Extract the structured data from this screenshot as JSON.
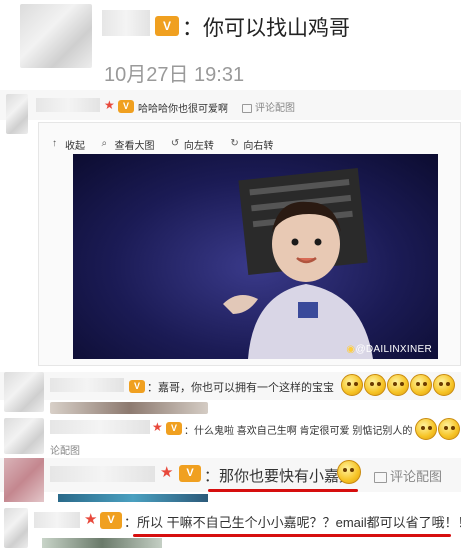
{
  "top": {
    "reply_text": "：你可以找山鸡哥",
    "timestamp": "10月27日 19:31"
  },
  "comment1": {
    "text": "哈哈哈你也很可爱啊",
    "action": "评论配图"
  },
  "image_viewer": {
    "toolbar": {
      "collapse": "收起",
      "view_large": "查看大图",
      "rotate_left": "向左转",
      "rotate_right": "向右转"
    },
    "watermark": "@DAILINXINER"
  },
  "comment2": {
    "text": "：嘉哥，你也可以拥有一个这样的宝宝"
  },
  "comment3": {
    "text": "：什么鬼啦 喜欢自己生啊 肯定很可爱 别惦记别人的"
  },
  "comment3_tail": {
    "text": "论配图"
  },
  "comment4": {
    "text": "：那你也要快有小嘉嘉",
    "action": "评论配图"
  },
  "comment5": {
    "text": "：所以 干嘛不自己生个小小嘉呢？？email都可以省了哦！！"
  },
  "colors": {
    "accent_red": "#d60e0e",
    "star": "#e8493c",
    "vip_badge": "#f0a020"
  }
}
